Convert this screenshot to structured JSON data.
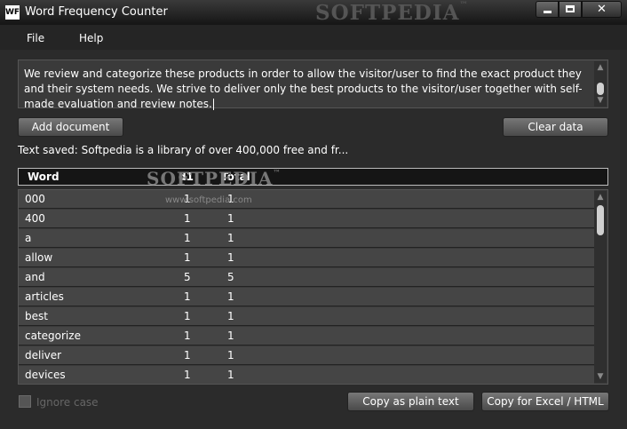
{
  "window": {
    "title": "Word Frequency Counter",
    "icon_text": "WF",
    "watermark": "SOFTPEDIA",
    "watermark_mark": "™",
    "close_glyph": "✕"
  },
  "menu": {
    "items": [
      {
        "label": "File"
      },
      {
        "label": "Help"
      }
    ]
  },
  "input": {
    "text": "We review and categorize these products in order to allow the visitor/user to find the exact product they and their system needs. We strive to deliver only the best products to the visitor/user together with self-made evaluation and review notes."
  },
  "buttons": {
    "add_document": "Add document",
    "clear_data": "Clear data",
    "copy_plain": "Copy as plain text",
    "copy_excel": "Copy for Excel / HTML"
  },
  "status": {
    "text": "Text saved: Softpedia is a library of over 400,000 free and fr..."
  },
  "table": {
    "columns": [
      "Word",
      "d1",
      "Total"
    ],
    "watermark": "SOFTPEDIA",
    "watermark_mark": "™",
    "watermark_url": "www.softpedia.com",
    "rows": [
      {
        "word": "000",
        "d1": "1",
        "total": "1"
      },
      {
        "word": "400",
        "d1": "1",
        "total": "1"
      },
      {
        "word": "a",
        "d1": "1",
        "total": "1"
      },
      {
        "word": "allow",
        "d1": "1",
        "total": "1"
      },
      {
        "word": "and",
        "d1": "5",
        "total": "5"
      },
      {
        "word": "articles",
        "d1": "1",
        "total": "1"
      },
      {
        "word": "best",
        "d1": "1",
        "total": "1"
      },
      {
        "word": "categorize",
        "d1": "1",
        "total": "1"
      },
      {
        "word": "deliver",
        "d1": "1",
        "total": "1"
      },
      {
        "word": "devices",
        "d1": "1",
        "total": "1"
      }
    ]
  },
  "options": {
    "ignore_case_label": "Ignore case",
    "ignore_case_checked": false
  }
}
